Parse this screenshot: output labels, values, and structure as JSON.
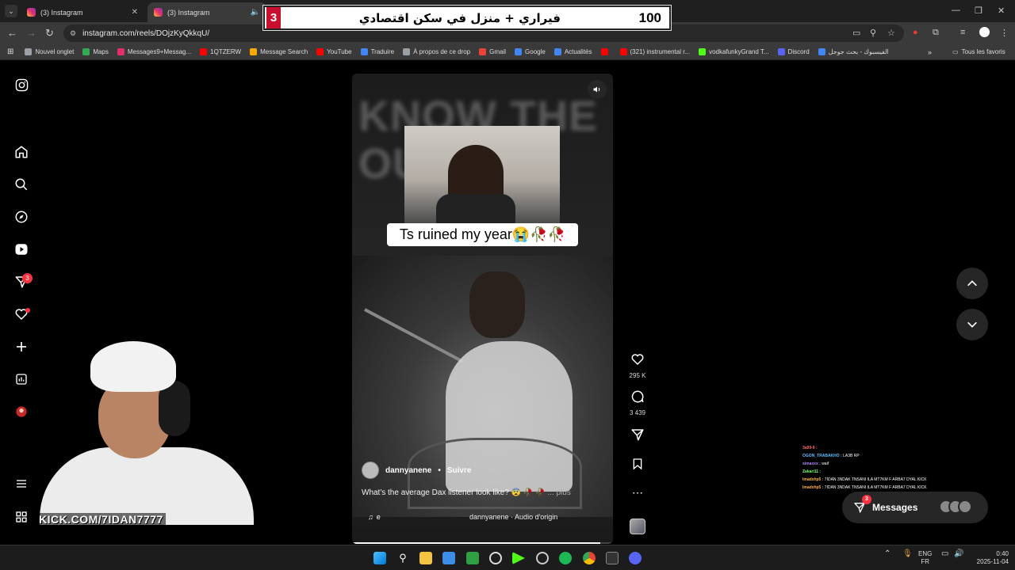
{
  "browser": {
    "tabs": [
      {
        "title": "(3) Instagram",
        "active": false
      },
      {
        "title": "(3) Instagram",
        "active": true
      }
    ],
    "url": "instagram.com/reels/DOjzKyQkkqU/",
    "bookmarks": [
      {
        "label": "Nouvel onglet",
        "color": "#9aa0a6"
      },
      {
        "label": "Maps",
        "color": "#34a853"
      },
      {
        "label": "Messages9+Messag...",
        "color": "#e1306c"
      },
      {
        "label": "1QTZERW",
        "color": "#ff0000"
      },
      {
        "label": "Message Search",
        "color": "#f9ab00"
      },
      {
        "label": "YouTube",
        "color": "#ff0000"
      },
      {
        "label": "Traduire",
        "color": "#4285f4"
      },
      {
        "label": "À propos de ce drop",
        "color": "#9aa0a6"
      },
      {
        "label": "Gmail",
        "color": "#ea4335"
      },
      {
        "label": "Google",
        "color": "#4285f4"
      },
      {
        "label": "Actualités",
        "color": "#4285f4"
      },
      {
        "label": "",
        "color": "#ff0000"
      },
      {
        "label": "(321) instrumental r...",
        "color": "#ff0000"
      },
      {
        "label": "vodkafunkyGrand T...",
        "color": "#53fc18"
      },
      {
        "label": "Discord",
        "color": "#5865f2"
      },
      {
        "label": "الفيسبوك - بحث جوجل",
        "color": "#4285f4"
      }
    ],
    "all_bookmarks": "Tous les favoris"
  },
  "banner": {
    "left_number": "3",
    "text": "فيراري + منزل في سكن اقتصادي",
    "right_number": "100"
  },
  "sidebar": {
    "notification_badge": "3"
  },
  "reel": {
    "background_text": "KNOW THE\nOU...",
    "caption": "Ts ruined my year😭🥀🥀",
    "author": "dannyanene",
    "follow": "Suivre",
    "description": "What's the average Dax listener look like? 😨 🥀 🥀",
    "more": "... plus",
    "music_label": "e",
    "audio": "dannyanene · Audio d'origin",
    "progress": 0.95
  },
  "actions": {
    "likes": "295 K",
    "comments": "3 439"
  },
  "chat": [
    {
      "user": "3a99-9 :",
      "text": "",
      "color": "#ff6b6b"
    },
    {
      "user": "OGON_TRABAKHO :",
      "text": "LA3B RP",
      "color": "#5bc0ff"
    },
    {
      "user": "simaxxx :",
      "text": "waif",
      "color": "#b388ff"
    },
    {
      "user": "Zakari11 :",
      "text": "",
      "color": "#7cff6b"
    },
    {
      "user": "lmadxhp5 :",
      "text": "7IDAN 3NDAK TNSANI ILA MT7KM F ARBA7 DYAL KICK",
      "color": "#ffb347"
    },
    {
      "user": "lmadxhp5 :",
      "text": "7IDAN 3NDAK TNSANI ILA MT7KM F ARBA7 DYAL KICK",
      "color": "#ffb347"
    }
  ],
  "messages": {
    "label": "Messages",
    "badge": "3"
  },
  "stream": {
    "overlay": "KICK.COM/7IDAN7777"
  },
  "taskbar": {
    "lang_top": "ENG",
    "lang_bottom": "FR",
    "time": "0:40",
    "date": "2025-11-04"
  }
}
